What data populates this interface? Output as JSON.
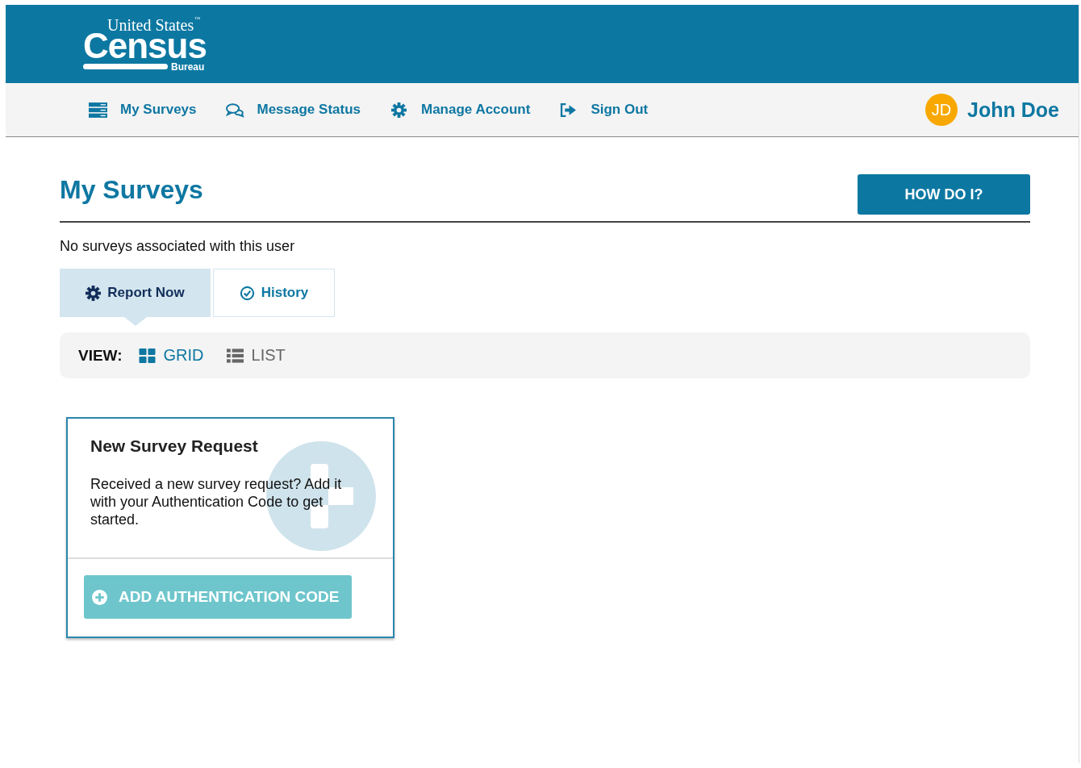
{
  "logo": {
    "top": "United States",
    "tm": "™",
    "main": "Census",
    "sub": "Bureau"
  },
  "nav": {
    "items": [
      {
        "label": "My Surveys",
        "kind": "surveys"
      },
      {
        "label": "Message Status",
        "kind": "messages"
      },
      {
        "label": "Manage Account",
        "kind": "account"
      },
      {
        "label": "Sign Out",
        "kind": "signout"
      }
    ],
    "user": {
      "initials": "JD",
      "name": "John Doe"
    }
  },
  "page": {
    "title": "My Surveys",
    "help_button": "HOW DO I?",
    "notice": "No surveys associated with this user"
  },
  "tabs": [
    {
      "label": "Report Now",
      "kind": "report",
      "selected": true
    },
    {
      "label": "History",
      "kind": "history",
      "selected": false
    }
  ],
  "view": {
    "label": "VIEW:",
    "options": [
      {
        "label": "GRID",
        "kind": "grid",
        "selected": true
      },
      {
        "label": "LIST",
        "kind": "list",
        "selected": false
      }
    ]
  },
  "card": {
    "title": "New Survey Request",
    "text": "Received a new survey request? Add it with your Authentication Code to get started.",
    "button": "ADD AUTHENTICATION CODE"
  }
}
